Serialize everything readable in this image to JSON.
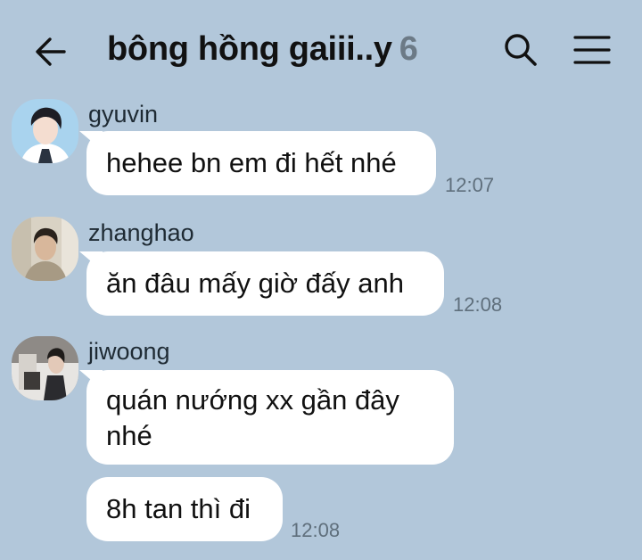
{
  "header": {
    "title": "bông hồng gaiii..y",
    "member_count": "6"
  },
  "messages": [
    {
      "sender": "gyuvin",
      "text": "hehee bn em đi hết nhé",
      "time": "12:07"
    },
    {
      "sender": "zhanghao",
      "text": "ăn đâu mấy giờ đấy anh",
      "time": "12:08"
    },
    {
      "sender": "jiwoong",
      "text": "quán nướng xx gần đây nhé",
      "time": ""
    },
    {
      "sender": "",
      "text": "8h tan thì đi",
      "time": "12:08"
    }
  ],
  "icons": {
    "back": "arrow-left-icon",
    "search": "search-icon",
    "menu": "hamburger-menu-icon"
  },
  "colors": {
    "background": "#b2c7da",
    "bubble": "#ffffff",
    "timestamp": "#5f6f7c"
  }
}
